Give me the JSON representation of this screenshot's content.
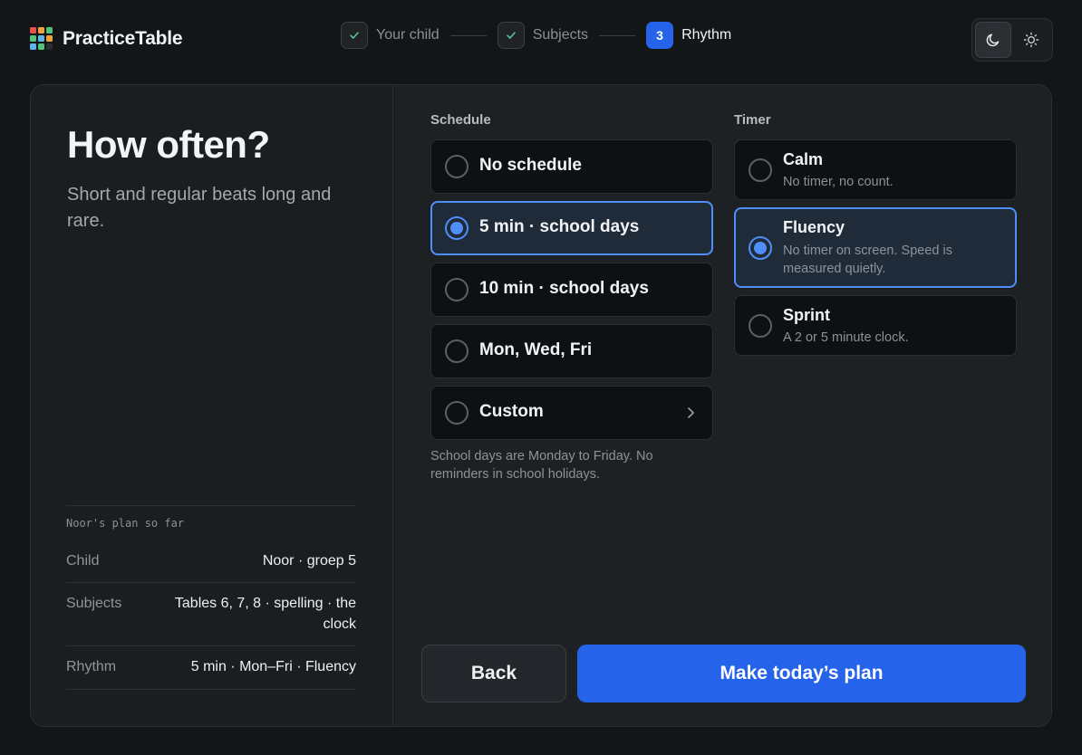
{
  "app": {
    "name": "PracticeTable",
    "logo_colors": [
      "#e5534b",
      "#f0a03c",
      "#53c27a",
      "#53c27a",
      "#5fb4e8",
      "#f0a03c",
      "#5fb4e8",
      "#53c27a",
      "#2b2f33"
    ]
  },
  "stepper": {
    "steps": [
      {
        "label": "Your child",
        "state": "done"
      },
      {
        "label": "Subjects",
        "state": "done"
      },
      {
        "number": "3",
        "label": "Rhythm",
        "state": "current"
      }
    ]
  },
  "theme": {
    "active": "dark",
    "options": [
      "moon-icon",
      "sun-icon"
    ]
  },
  "intro": {
    "title": "How often?",
    "subtitle": "Short and regular beats long and rare."
  },
  "summary": {
    "heading": "Noor's plan so far",
    "rows": [
      {
        "key": "Child",
        "value": "Noor · groep 5"
      },
      {
        "key": "Subjects",
        "value": "Tables 6, 7, 8 · spelling · the clock"
      },
      {
        "key": "Rhythm",
        "value": "5 min · Mon–Fri · Fluency"
      }
    ]
  },
  "schedule": {
    "label": "Schedule",
    "options": [
      {
        "label": "No schedule",
        "selected": false
      },
      {
        "label": "5 min · school days",
        "selected": true
      },
      {
        "label": "10 min · school days",
        "selected": false
      },
      {
        "label": "Mon, Wed, Fri",
        "selected": false
      },
      {
        "label": "Custom",
        "selected": false,
        "icon": "chevron-right-icon"
      }
    ],
    "note": "School days are Monday to Friday. No reminders in school holidays."
  },
  "timer": {
    "label": "Timer",
    "options": [
      {
        "label": "Calm",
        "description": "No timer, no count.",
        "selected": false
      },
      {
        "label": "Fluency",
        "description": "No timer on screen. Speed is measured quietly.",
        "selected": true
      },
      {
        "label": "Sprint",
        "description": "A 2 or 5 minute clock.",
        "selected": false
      }
    ]
  },
  "actions": {
    "back_label": "Back",
    "primary_label": "Make today’s plan"
  },
  "colors": {
    "accent": "#2563eb",
    "selection": "#4f8ef7",
    "check": "#5fbf8c",
    "background": "#131517"
  }
}
